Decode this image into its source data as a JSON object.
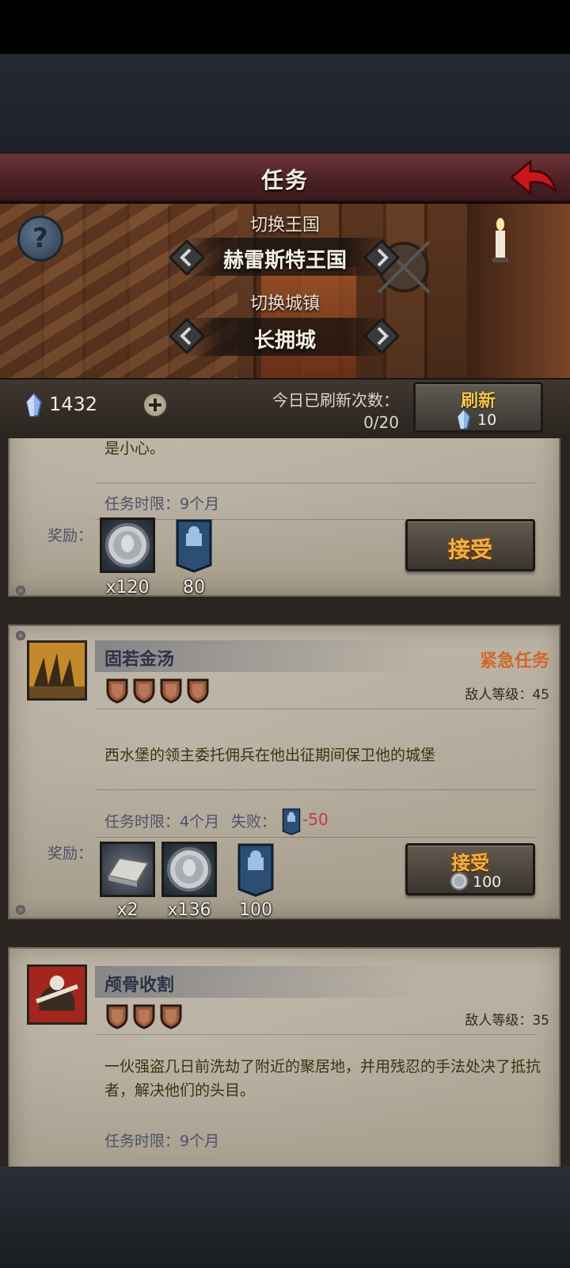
{
  "header": {
    "title": "任务"
  },
  "selectors": {
    "kingdom_label": "切换王国",
    "kingdom_value": "赫雷斯特王国",
    "town_label": "切换城镇",
    "town_value": "长拥城"
  },
  "currency": {
    "crystals": "1432"
  },
  "refresh": {
    "label": "今日已刷新次数：",
    "count": "0/20",
    "button_label": "刷新",
    "cost": "10"
  },
  "missions": [
    {
      "desc_fragment": "是小心。",
      "time_limit": "任务时限：9个月",
      "reward_label": "奖励：",
      "rewards": [
        {
          "icon": "silver-coin-icon",
          "qty": "x120"
        },
        {
          "icon": "banner-icon",
          "qty": "80"
        }
      ],
      "accept_label": "接受"
    },
    {
      "title": "固若金汤",
      "tag": "紧急任务",
      "enemy_level": "敌人等级：45",
      "difficulty": 4,
      "description": "西水堡的领主委托佣兵在他出征期间保卫他的城堡",
      "time_limit": "任务时限：4个月",
      "fail_label": "失败：",
      "fail_value": "-50",
      "reward_label": "奖励：",
      "rewards": [
        {
          "icon": "iron-ingot-icon",
          "qty": "x2"
        },
        {
          "icon": "silver-coin-icon",
          "qty": "x136"
        },
        {
          "icon": "banner-icon",
          "qty": "100"
        }
      ],
      "accept_label": "接受",
      "accept_cost": "100"
    },
    {
      "title": "颅骨收割",
      "enemy_level": "敌人等级：35",
      "difficulty": 3,
      "description": "一伙强盗几日前洗劫了附近的聚居地，并用残忍的手法处决了抵抗者，解决他们的头目。",
      "time_limit_fragment": "任务时限：9个月"
    }
  ],
  "colors": {
    "header_red": "#5a272b",
    "urgent_orange": "#d2672a",
    "accept_gold": "#f3b143",
    "fail_red": "#c33c3c",
    "parchment": "#b3ab9b"
  }
}
